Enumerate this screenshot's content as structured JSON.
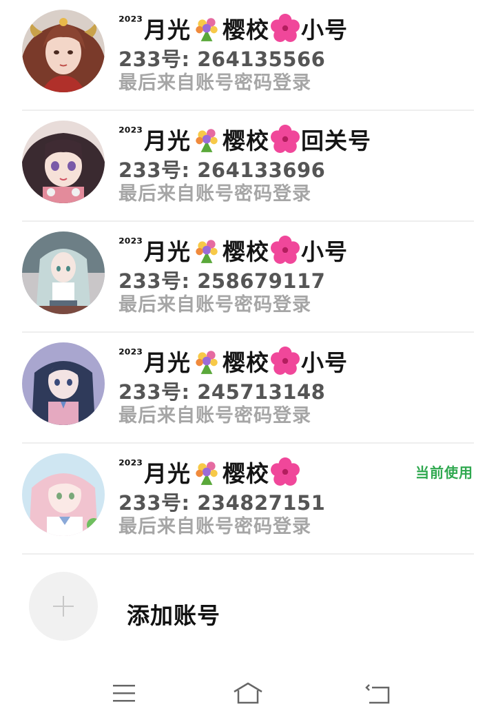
{
  "accounts": [
    {
      "name_prefix": "2023",
      "name_part1": "月光",
      "name_part2": "樱校",
      "name_suffix": "小号",
      "id_text": "233号: 264135566",
      "login_text": "最后来自账号密码登录",
      "avatar": "red-haired-girl-avatar",
      "current": false
    },
    {
      "name_prefix": "2023",
      "name_part1": "月光",
      "name_part2": "樱校",
      "name_suffix": "回关号",
      "id_text": "233号: 264133696",
      "login_text": "最后来自账号密码登录",
      "avatar": "dark-haired-girl-avatar",
      "current": false
    },
    {
      "name_prefix": "2023",
      "name_part1": "月光",
      "name_part2": "樱校",
      "name_suffix": "小号",
      "id_text": "233号: 258679117",
      "login_text": "最后来自账号密码登录",
      "avatar": "silver-haired-girl-avatar",
      "current": false
    },
    {
      "name_prefix": "2023",
      "name_part1": "月光",
      "name_part2": "樱校",
      "name_suffix": "小号",
      "id_text": "233号: 245713148",
      "login_text": "最后来自账号密码登录",
      "avatar": "navy-haired-girl-avatar",
      "current": false
    },
    {
      "name_prefix": "2023",
      "name_part1": "月光",
      "name_part2": "樱校",
      "name_suffix": "",
      "id_text": "233号: 234827151",
      "login_text": "最后来自账号密码登录",
      "avatar": "pink-haired-girl-avatar",
      "current": true,
      "current_label": "当前使用"
    }
  ],
  "add_account": {
    "label": "添加账号",
    "icon": "plus-icon"
  },
  "nav": {
    "menu_icon": "menu-icon",
    "home_icon": "home-icon",
    "back_icon": "back-icon"
  },
  "colors": {
    "current_badge": "#2fa84f",
    "login_text": "#a6a6a6",
    "id_text": "#555555"
  }
}
